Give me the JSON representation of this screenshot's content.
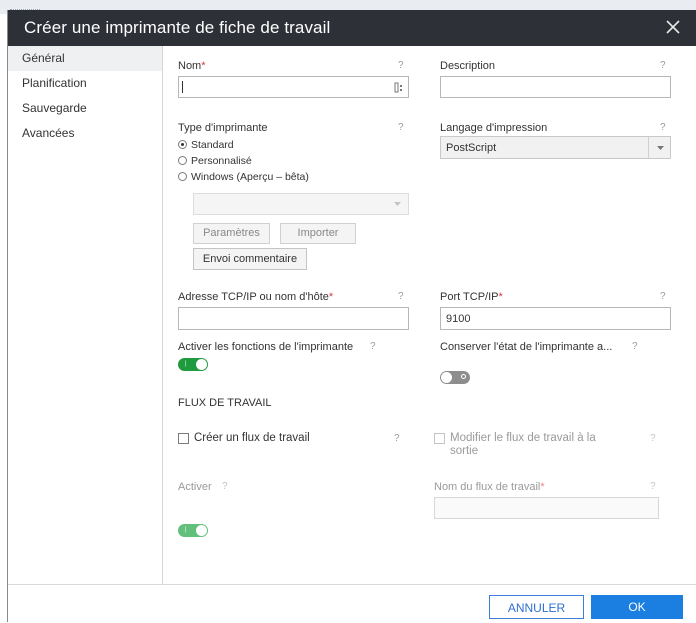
{
  "dialog": {
    "title": "Créer une imprimante de fiche de travail",
    "close_label": "×"
  },
  "sidebar": {
    "items": [
      {
        "label": "Général",
        "active": true
      },
      {
        "label": "Planification",
        "active": false
      },
      {
        "label": "Sauvegarde",
        "active": false
      },
      {
        "label": "Avancées",
        "active": false
      }
    ]
  },
  "form": {
    "help": "?",
    "required_mark": "*",
    "nom": {
      "label": "Nom",
      "value": ""
    },
    "description": {
      "label": "Description",
      "value": ""
    },
    "type_imprimante": {
      "label": "Type d'imprimante",
      "options": [
        {
          "label": "Standard",
          "selected": true
        },
        {
          "label": "Personnalisé",
          "selected": false
        },
        {
          "label": "Windows (Aperçu – bêta)",
          "selected": false
        }
      ],
      "windows_select_value": "",
      "parametres_label": "Paramètres",
      "importer_label": "Importer",
      "envoi_label": "Envoi commentaire"
    },
    "langage": {
      "label": "Langage d'impression",
      "value": "PostScript"
    },
    "adresse": {
      "label": "Adresse TCP/IP ou nom d'hôte",
      "value": ""
    },
    "port": {
      "label": "Port TCP/IP",
      "value": "9100"
    },
    "activer_fonctions": {
      "label": "Activer les fonctions de l'imprimante",
      "on": true
    },
    "conserver_etat": {
      "label": "Conserver l'état de l'imprimante a...",
      "on": false
    },
    "flux": {
      "section_title": "FLUX DE TRAVAIL",
      "creer_label": "Créer un flux de travail",
      "modifier_label_line1": "Modifier le flux de travail à la",
      "modifier_label_line2": "sortie",
      "activer_label": "Activer",
      "activer_on": true,
      "nom_flux_label": "Nom du flux de travail",
      "nom_flux_value": ""
    }
  },
  "footer": {
    "cancel_label": "ANNULER",
    "ok_label": "OK"
  },
  "colors": {
    "header_bg": "#2d3037",
    "toggle_on": "#1f9a3e",
    "primary": "#1a7fe0",
    "required": "#d23a3a"
  }
}
